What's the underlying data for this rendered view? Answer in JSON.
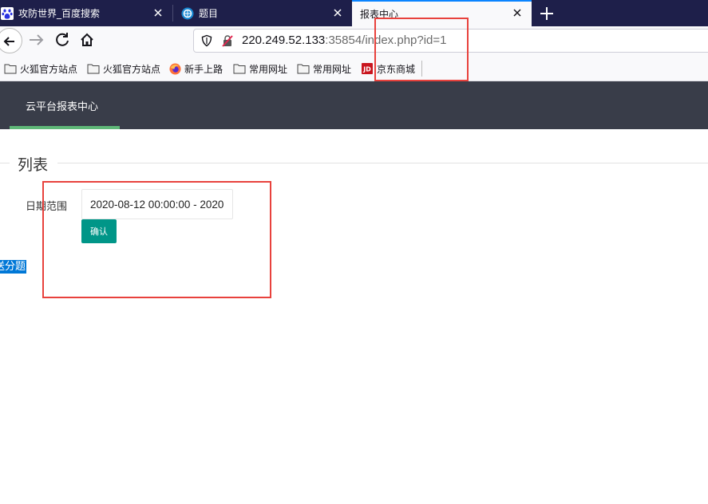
{
  "tabs": [
    {
      "title": "攻防世界_百度搜索",
      "icon": "baidu-paw-icon",
      "active": false
    },
    {
      "title": "题目",
      "icon": "xctf-icon",
      "active": false
    },
    {
      "title": "报表中心",
      "icon": "",
      "active": true
    }
  ],
  "nav": {
    "url_host": "220.249.52.133",
    "url_rest": ":35854/index.php?id=1"
  },
  "bookmarks": [
    {
      "label": "火狐官方站点",
      "icon": "folder-icon"
    },
    {
      "label": "火狐官方站点",
      "icon": "folder-icon"
    },
    {
      "label": "新手上路",
      "icon": "firefox-icon"
    },
    {
      "label": "常用网址",
      "icon": "folder-icon"
    },
    {
      "label": "常用网址",
      "icon": "folder-icon"
    },
    {
      "label": "京东商城",
      "icon": "jd-icon"
    }
  ],
  "page": {
    "header_title": "云平台报表中心",
    "section_title": "列表",
    "date_label": "日期范围",
    "date_value": "2020-08-12 00:00:00 - 2020",
    "confirm_label": "确认",
    "selected_text": "送分题"
  },
  "colors": {
    "tabstrip": "#1e1f4a",
    "active_tab_accent": "#0a84ff",
    "header_bg": "#393d49",
    "header_underline": "#5fb878",
    "confirm_button": "#009688",
    "selection": "#0078d7",
    "annotation_red": "#e8423d"
  }
}
